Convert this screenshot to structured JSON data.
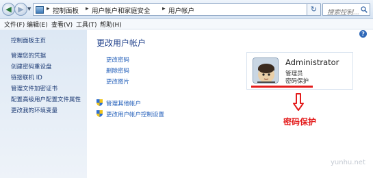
{
  "address_bar": {
    "crumbs": [
      "控制面板",
      "用户帐户和家庭安全",
      "用户帐户"
    ],
    "search_placeholder": "搜索控制...",
    "icons": [
      "back-arrow-icon",
      "forward-arrow-icon",
      "control-panel-icon",
      "refresh-icon",
      "search-icon"
    ]
  },
  "menu": {
    "items": [
      "文件(F)",
      "编辑(E)",
      "查看(V)",
      "工具(T)",
      "帮助(H)"
    ]
  },
  "nav": {
    "home": "控制面板主页",
    "links": [
      "管理您的凭据",
      "创建密码重设盘",
      "链接联机 ID",
      "管理文件加密证书",
      "配置高级用户配置文件属性",
      "更改我的环境变量"
    ]
  },
  "main": {
    "title": "更改用户帐户",
    "tasks": [
      "更改密码",
      "删除密码",
      "更改图片"
    ],
    "shield_links": [
      "管理其他帐户",
      "更改用户帐户控制设置"
    ]
  },
  "account": {
    "name": "Administrator",
    "role": "管理员",
    "status": "密码保护"
  },
  "annotation": {
    "label": "密码保护",
    "color": "#e31b1b"
  },
  "watermark": "yunhu.net"
}
